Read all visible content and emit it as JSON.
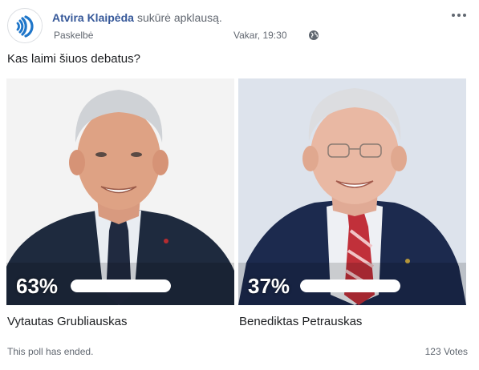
{
  "post": {
    "author": "Atvira Klaipėda",
    "action": "sukūrė apklausą.",
    "posted_label": "Paskelbė",
    "timestamp": "Vakar, 19:30",
    "privacy_icon": "globe-icon",
    "more_icon": "more-options-icon"
  },
  "poll": {
    "question": "Kas laimi šiuos debatus?",
    "options": [
      {
        "name": "Vytautas Grubliauskas",
        "percent_label": "63%",
        "percent": 63
      },
      {
        "name": "Benediktas Petrauskas",
        "percent_label": "37%",
        "percent": 37
      }
    ],
    "status": "This poll has ended.",
    "votes": "123 Votes"
  },
  "colors": {
    "link": "#365899",
    "meta": "#616770",
    "brand": "#1f76c9"
  }
}
